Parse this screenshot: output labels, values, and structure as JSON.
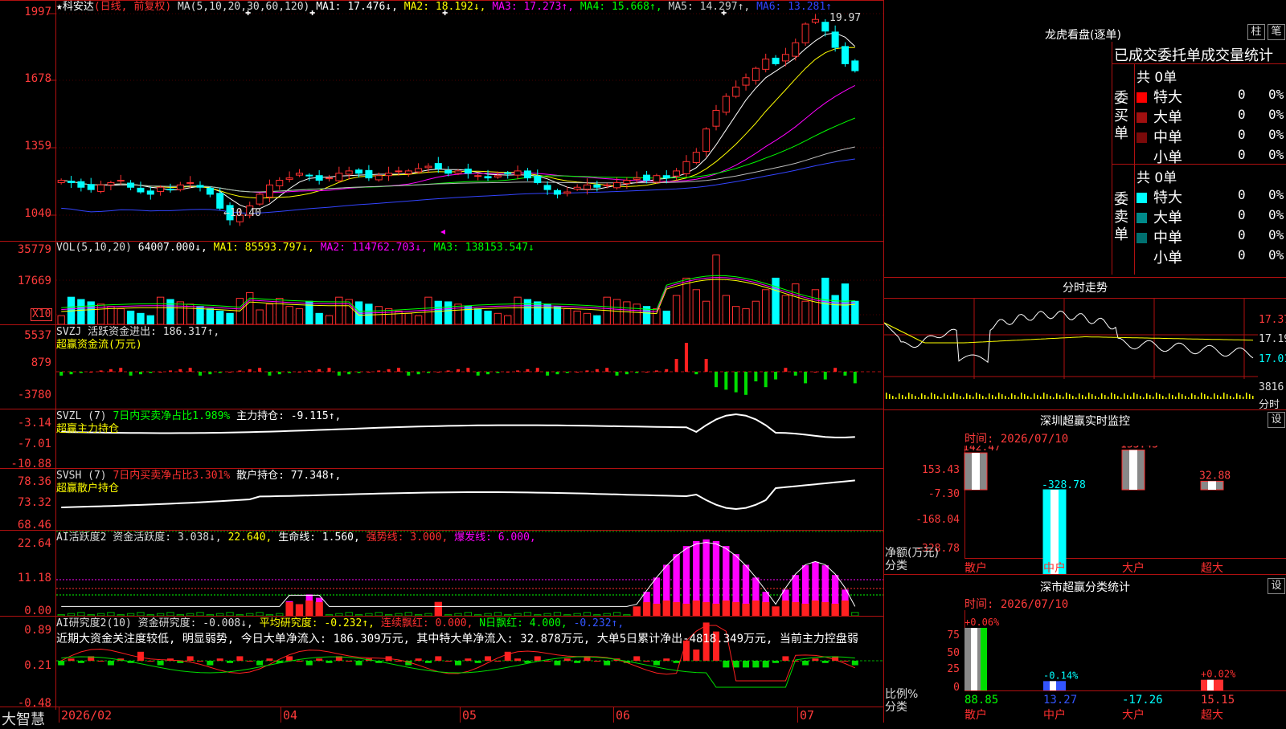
{
  "stock": {
    "star": "★",
    "name": "科安达",
    "period": "(日线, 前复权)",
    "ma_params": "MA(5,10,20,30,60,120)",
    "mas": [
      {
        "label": "MA1:",
        "value": "17.476↓,",
        "color": "#ffffff"
      },
      {
        "label": "MA2:",
        "value": "18.192↓,",
        "color": "#ffff00"
      },
      {
        "label": "MA3:",
        "value": "17.273↑,",
        "color": "#ff00ff"
      },
      {
        "label": "MA4:",
        "value": "15.668↑,",
        "color": "#00ff00"
      },
      {
        "label": "MA5:",
        "value": "14.297↑,",
        "color": "#cccccc"
      },
      {
        "label": "MA6:",
        "value": "13.281↑",
        "color": "#3344ff"
      }
    ],
    "high_label": "19.97",
    "low_label": "←10.40"
  },
  "main_axis": [
    "1997",
    "1678",
    "1359",
    "1040"
  ],
  "vol": {
    "header": "VOL(5,10,20)",
    "value": "64007.000↓,",
    "ma1": "MA1: 85593.797↓,",
    "ma2": "MA2: 114762.703↓,",
    "ma3": "MA3: 138153.547↓",
    "axis": [
      "35779",
      "17669"
    ],
    "unit": "X10"
  },
  "svzj": {
    "header": "SVZJ  活跃资金进出: 186.317↑,",
    "sub": "超赢资金流(万元)",
    "axis": [
      "5537",
      "879",
      "-3780"
    ]
  },
  "svzl": {
    "header": "SVZL (7)",
    "c1": "7日内买卖净占比1.989%",
    "c2": "主力持仓: -9.115↑,",
    "sub": "超赢主力持仓",
    "axis": [
      "-3.14",
      "-7.01",
      "-10.88"
    ]
  },
  "svsh": {
    "header": "SVSH (7)",
    "c1": "7日内买卖净占比3.301%",
    "c2": "散户持仓: 77.348↑,",
    "sub": "超赢散户持仓",
    "axis": [
      "78.36",
      "73.32",
      "68.46"
    ]
  },
  "ai1": {
    "header": "AI活跃度2 资金活跃度: 3.038↓,",
    "c1": "22.640,",
    "c2": "生命线: 1.560,",
    "c3": "强势线: 3.000,",
    "c4": "爆发线: 6.000,",
    "axis": [
      "22.64",
      "11.18",
      "0.00"
    ]
  },
  "ai2": {
    "header": "AI研究度2(10) 资金研究度: -0.008↓,",
    "c1": "平均研究度: -0.232↑,",
    "c2": "连续飘红: 0.000,",
    "c3": "N日飘红: 4.000,",
    "c4": "-0.232↑,",
    "note": "近期大资金关注度较低, 明显弱势, 今日大单净流入: 186.309万元, 其中特大单净流入: 32.878万元, 大单5日累计净出-4818.349万元, 当前主力控盘弱",
    "axis": [
      "0.89",
      "0.21",
      "-0.48"
    ]
  },
  "xaxis": {
    "brand": "大智慧",
    "labels": [
      "2026/02",
      "04",
      "05",
      "06",
      "07"
    ]
  },
  "dragon": {
    "title": "龙虎看盘(逐单)",
    "btn1": "柱",
    "btn2": "笔",
    "header": "已成交委托单成交量统计",
    "buy": {
      "side": "委买单",
      "total": "共 0单",
      "rows": [
        {
          "name": "特大",
          "n": "0",
          "p": "0%",
          "c": "#ff0000"
        },
        {
          "name": "大单",
          "n": "0",
          "p": "0%",
          "c": "#a01010"
        },
        {
          "name": "中单",
          "n": "0",
          "p": "0%",
          "c": "#7a0a0a"
        },
        {
          "name": "小单",
          "n": "0",
          "p": "0%",
          "c": "#000000"
        }
      ]
    },
    "sell": {
      "side": "委卖单",
      "total": "共 0单",
      "rows": [
        {
          "name": "特大",
          "n": "0",
          "p": "0%",
          "c": "#00ffff"
        },
        {
          "name": "大单",
          "n": "0",
          "p": "0%",
          "c": "#008a8a"
        },
        {
          "name": "中单",
          "n": "0",
          "p": "0%",
          "c": "#007070"
        },
        {
          "name": "小单",
          "n": "0",
          "p": "0%",
          "c": "#000000"
        }
      ]
    }
  },
  "intraday": {
    "title": "分时走势",
    "axis": [
      "17.37",
      "17.19",
      "17.01",
      "3816"
    ],
    "foot": "分时"
  },
  "sz_monitor": {
    "title": "深圳超赢实时监控",
    "set": "设",
    "time": "时间: 2026/07/10",
    "axis": [
      "153.43",
      "-7.30",
      "-168.04",
      "-328.78"
    ],
    "ylab1": "净额(万元)",
    "ylab2": "分类",
    "bars": [
      {
        "cat": "散户",
        "val": 142.47,
        "label": "142.47",
        "lc": "#ff4040"
      },
      {
        "cat": "中户",
        "val": -328.78,
        "label": "-328.78",
        "lc": "#00ffff"
      },
      {
        "cat": "大户",
        "val": 153.43,
        "label": "153.43",
        "lc": "#ff4040"
      },
      {
        "cat": "超大",
        "val": 32.88,
        "label": "32.88",
        "lc": "#ff4040"
      }
    ]
  },
  "sz_class": {
    "title": "深市超赢分类统计",
    "set": "设",
    "time": "时间: 2026/07/10",
    "axis": [
      "75",
      "50",
      "25",
      "0"
    ],
    "ylab1": "比例%",
    "ylab2": "分类",
    "bars": [
      {
        "cat": "散户",
        "pct": 88.85,
        "top": "+0.06%",
        "val": "88.85",
        "vc": "#00ff00"
      },
      {
        "cat": "中户",
        "pct": 13.27,
        "top": "-0.14%",
        "val": "13.27",
        "vc": "#3355ff"
      },
      {
        "cat": "大户",
        "pct": 0,
        "top": "",
        "val": "-17.26",
        "vc": "#00ffff"
      },
      {
        "cat": "超大",
        "pct": 15.15,
        "top": "+0.02%",
        "val": "15.15",
        "vc": "#ff4040"
      }
    ]
  },
  "chart_data": [
    {
      "type": "candlestick",
      "title": "科安达 (日线, 前复权)",
      "ylim": [
        10.4,
        19.97
      ],
      "x": [
        "2026/02",
        "04",
        "05",
        "06",
        "07"
      ],
      "close": [
        12.6,
        12.5,
        12.3,
        12.2,
        12.4,
        12.5,
        12.6,
        12.3,
        12.1,
        12.0,
        12.3,
        12.2,
        12.4,
        12.5,
        12.3,
        12.0,
        11.4,
        10.9,
        11.1,
        11.5,
        12.0,
        12.4,
        12.6,
        12.7,
        12.9,
        12.8,
        12.6,
        12.7,
        12.9,
        13.0,
        12.9,
        12.7,
        12.8,
        12.9,
        13.0,
        13.0,
        13.1,
        13.2,
        13.1,
        12.9,
        13.0,
        12.9,
        12.8,
        12.7,
        12.8,
        12.9,
        13.0,
        12.7,
        12.5,
        12.2,
        12.0,
        12.1,
        12.3,
        12.4,
        12.3,
        12.4,
        12.5,
        12.6,
        12.7,
        12.6,
        12.8,
        12.7,
        13.0,
        13.4,
        13.8,
        14.8,
        15.6,
        16.2,
        16.6,
        17.0,
        17.4,
        17.8,
        17.6,
        18.0,
        18.5,
        19.3,
        19.5,
        19.0,
        18.3,
        17.6,
        17.3
      ],
      "series": [
        {
          "name": "MA1",
          "last": 17.476
        },
        {
          "name": "MA2",
          "last": 18.192
        },
        {
          "name": "MA3",
          "last": 17.273
        },
        {
          "name": "MA4",
          "last": 15.668
        },
        {
          "name": "MA5",
          "last": 14.297
        },
        {
          "name": "MA6",
          "last": 13.281
        }
      ]
    },
    {
      "type": "bar",
      "title": "VOL(5,10,20)",
      "ylim": [
        0,
        35779
      ],
      "last": 64007.0
    }
  ]
}
